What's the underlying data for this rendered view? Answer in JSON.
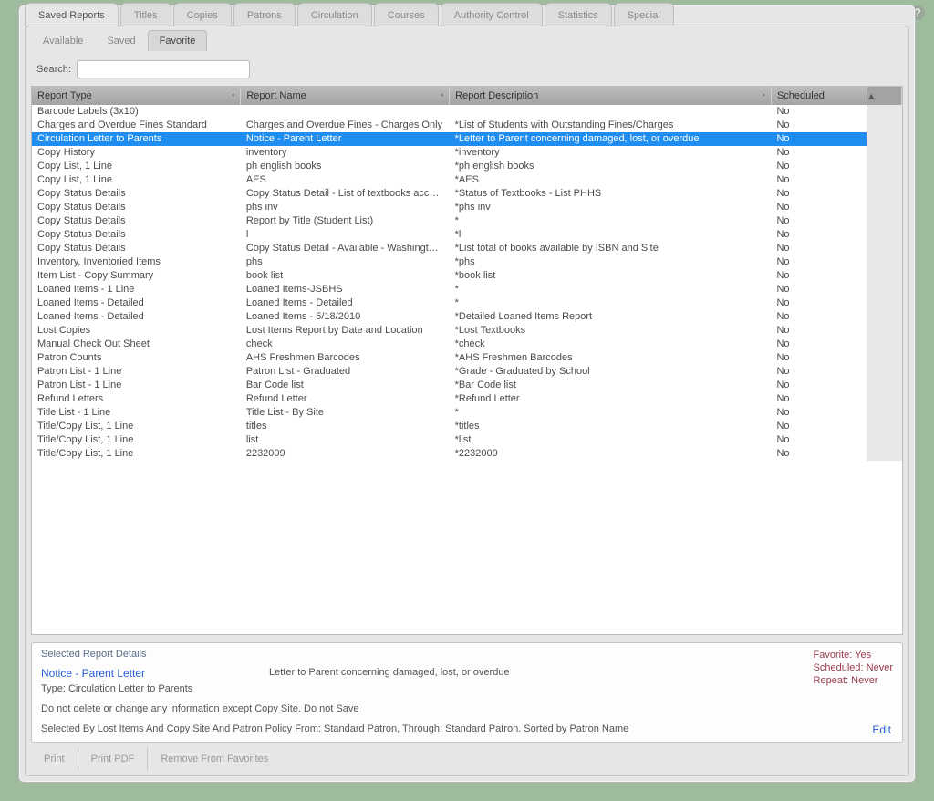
{
  "main_tabs": [
    "Saved Reports",
    "Titles",
    "Copies",
    "Patrons",
    "Circulation",
    "Courses",
    "Authority Control",
    "Statistics",
    "Special"
  ],
  "main_tab_active": 0,
  "sub_tabs": [
    "Available",
    "Saved",
    "Favorite"
  ],
  "sub_tab_active": 2,
  "search_label": "Search:",
  "columns": [
    "Report Type",
    "Report Name",
    "Report Description",
    "Scheduled"
  ],
  "rows": [
    {
      "type": "Barcode Labels (3x10)",
      "name": "",
      "desc": "",
      "sched": "No"
    },
    {
      "type": "Charges and Overdue Fines Standard",
      "name": "Charges and Overdue Fines - Charges Only",
      "desc": "*List of Students with Outstanding Fines/Charges",
      "sched": "No"
    },
    {
      "type": "Circulation Letter to Parents",
      "name": "Notice - Parent Letter",
      "desc": "*Letter to Parent concerning damaged, lost, or overdue",
      "sched": "No",
      "selected": true
    },
    {
      "type": "Copy History",
      "name": "inventory",
      "desc": "*inventory",
      "sched": "No"
    },
    {
      "type": "Copy List, 1 Line",
      "name": "ph english books",
      "desc": "*ph english books",
      "sched": "No"
    },
    {
      "type": "Copy List, 1 Line",
      "name": "AES",
      "desc": "*AES",
      "sched": "No"
    },
    {
      "type": "Copy Status Details",
      "name": "Copy Status Detail - List of textbooks according to clas",
      "desc": "*Status of Textbooks - List PHHS",
      "sched": "No"
    },
    {
      "type": "Copy Status Details",
      "name": "phs inv",
      "desc": "*phs inv",
      "sched": "No"
    },
    {
      "type": "Copy Status Details",
      "name": "Report by Title (Student List)",
      "desc": "*",
      "sched": "No"
    },
    {
      "type": "Copy Status Details",
      "name": "l",
      "desc": "*l",
      "sched": "No"
    },
    {
      "type": "Copy Status Details",
      "name": "Copy Status Detail - Available - Washington Co School",
      "desc": "*List total of books available by ISBN and Site",
      "sched": "No"
    },
    {
      "type": "Inventory, Inventoried Items",
      "name": "phs",
      "desc": "*phs",
      "sched": "No"
    },
    {
      "type": "Item List - Copy Summary",
      "name": "book list",
      "desc": "*book list",
      "sched": "No"
    },
    {
      "type": "Loaned Items - 1 Line",
      "name": "Loaned Items-JSBHS",
      "desc": "*",
      "sched": "No"
    },
    {
      "type": "Loaned Items - Detailed",
      "name": "Loaned Items - Detailed",
      "desc": "*",
      "sched": "No"
    },
    {
      "type": "Loaned Items - Detailed",
      "name": "Loaned Items - 5/18/2010",
      "desc": "*Detailed Loaned Items Report",
      "sched": "No"
    },
    {
      "type": "Lost Copies",
      "name": "Lost Items Report by Date and Location",
      "desc": "*Lost Textbooks",
      "sched": "No"
    },
    {
      "type": "Manual Check Out Sheet",
      "name": "check",
      "desc": "*check",
      "sched": "No"
    },
    {
      "type": "Patron Counts",
      "name": "AHS Freshmen Barcodes",
      "desc": "*AHS Freshmen Barcodes",
      "sched": "No"
    },
    {
      "type": "Patron List - 1 Line",
      "name": "Patron List - Graduated",
      "desc": "*Grade - Graduated by School",
      "sched": "No"
    },
    {
      "type": "Patron List - 1 Line",
      "name": "Bar Code list",
      "desc": "*Bar Code list",
      "sched": "No"
    },
    {
      "type": "Refund Letters",
      "name": "Refund Letter",
      "desc": "*Refund Letter",
      "sched": "No"
    },
    {
      "type": "Title List - 1 Line",
      "name": "Title List - By Site",
      "desc": "*",
      "sched": "No"
    },
    {
      "type": "Title/Copy List, 1 Line",
      "name": "titles",
      "desc": "*titles",
      "sched": "No"
    },
    {
      "type": "Title/Copy List, 1 Line",
      "name": "list",
      "desc": "*list",
      "sched": "No"
    },
    {
      "type": "Title/Copy List, 1 Line",
      "name": "2232009",
      "desc": "*2232009",
      "sched": "No"
    }
  ],
  "details": {
    "panel_title": "Selected Report Details",
    "name": "Notice - Parent Letter",
    "desc": "Letter to Parent concerning damaged, lost, or overdue",
    "type_label": "Type: Circulation Letter to Parents",
    "note": "Do not delete or change any information except Copy Site. Do not Save",
    "selected_by": "Selected By Lost Items  And Copy Site  And Patron Policy From: Standard Patron, Through: Standard Patron. Sorted by Patron Name",
    "favorite": "Favorite: Yes",
    "scheduled": "Scheduled: Never",
    "repeat": "Repeat: Never",
    "edit": "Edit"
  },
  "bottom_buttons": [
    "Print",
    "Print PDF",
    "Remove From Favorites"
  ]
}
